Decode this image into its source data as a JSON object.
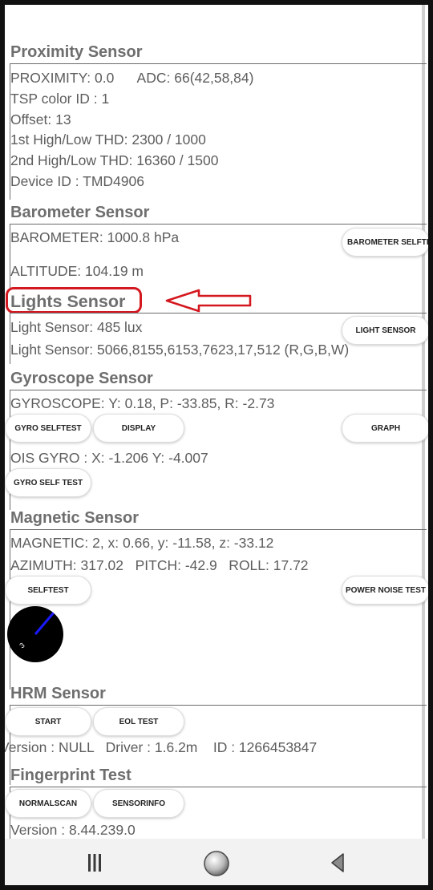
{
  "proximity": {
    "title": "Proximity Sensor",
    "line1": "PROXIMITY: 0.0      ADC: 66(42,58,84)",
    "line2": "TSP color ID : 1",
    "line3": "Offset: 13",
    "line4": "1st High/Low THD: 2300 / 1000",
    "line5": "2nd High/Low THD: 16360 / 1500",
    "line6": "Device ID : TMD4906"
  },
  "barometer": {
    "title": "Barometer Sensor",
    "value": "BAROMETER: 1000.8 hPa",
    "altitude": "ALTITUDE: 104.19 m",
    "selftest_label": "BAROMETER SELFTEST"
  },
  "lights": {
    "title": "Lights Sensor",
    "lux": "Light Sensor: 485 lux",
    "rgbw": "Light Sensor: 5066,8155,6153,7623,17,512 (R,G,B,W)",
    "button_label": "LIGHT SENSOR"
  },
  "gyroscope": {
    "title": "Gyroscope Sensor",
    "value": "GYROSCOPE: Y: 0.18, P: -33.85, R: -2.73",
    "selftest_label": "GYRO SELFTEST",
    "display_label": "DISPLAY",
    "graph_label": "GRAPH",
    "ois": "OIS GYRO : X: -1.206 Y: -4.007",
    "ois_selftest_label": "GYRO SELF TEST"
  },
  "magnetic": {
    "title": "Magnetic Sensor",
    "value": "MAGNETIC: 2, x: 0.66, y: -11.58, z: -33.12",
    "orientation": "AZIMUTH: 317.02   PITCH: -42.9   ROLL: 17.72",
    "selftest_label": "SELFTEST",
    "power_noise_label": "POWER NOISE TEST",
    "compass_digit": "3"
  },
  "hrm": {
    "title": "HRM Sensor",
    "start_label": "START",
    "eol_label": "EOL TEST",
    "version": "Version : NULL   Driver : 1.6.2m    ID : 1266453847"
  },
  "fingerprint": {
    "title": "Fingerprint Test",
    "normalscan_label": "NORMALSCAN",
    "sensorinfo_label": "SENSORINFO",
    "version": "Version : 8.44.239.0"
  },
  "navigation": {
    "recents": "recents-icon",
    "home": "home-icon",
    "back": "back-icon"
  },
  "colors": {
    "annotation": "#d4181f",
    "header_text": "#6e6e6e",
    "body_text": "#5d5d5d",
    "compass_needle": "#1a1aff"
  }
}
